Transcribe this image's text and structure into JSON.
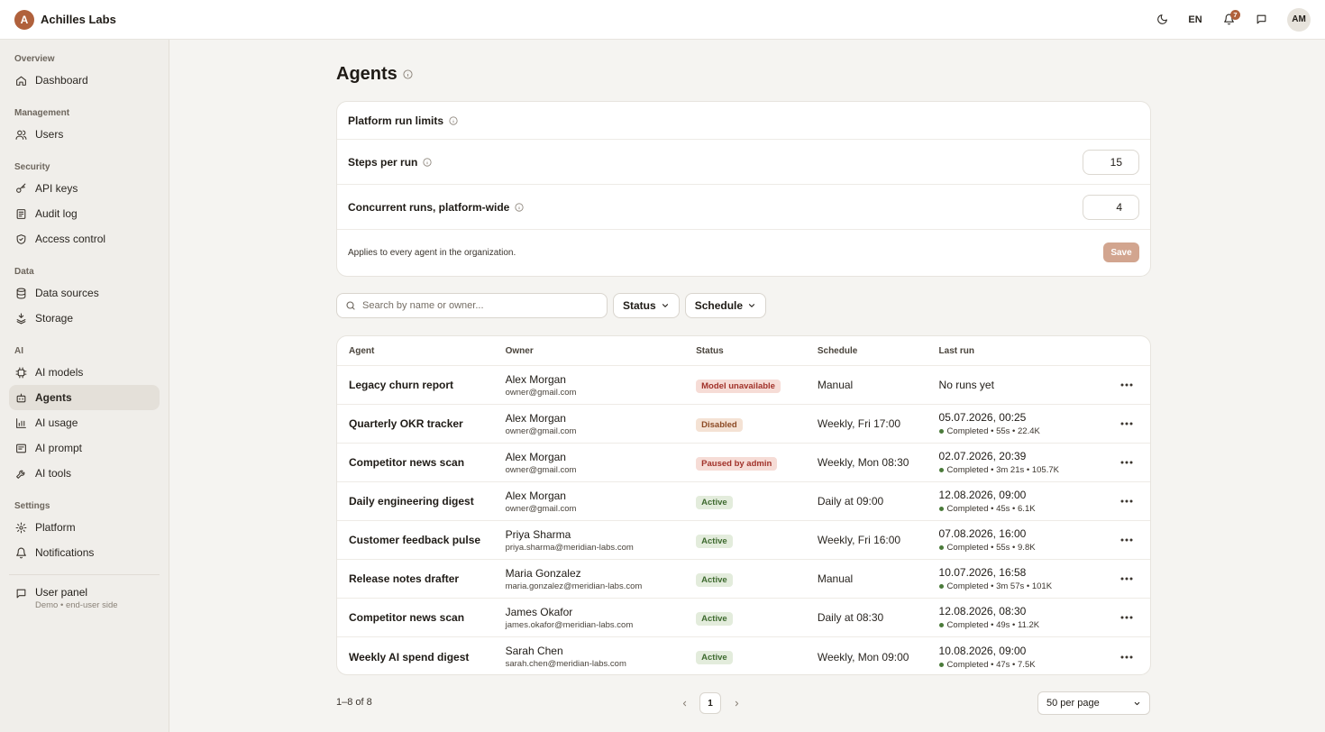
{
  "app": {
    "logo_letter": "A",
    "name": "Achilles Labs"
  },
  "topbar": {
    "lang": "EN",
    "notif_count": "7",
    "avatar": "AM"
  },
  "sidebar": {
    "groups": [
      {
        "label": "Overview",
        "items": [
          {
            "label": "Dashboard",
            "icon": "home-icon"
          }
        ]
      },
      {
        "label": "Management",
        "items": [
          {
            "label": "Users",
            "icon": "users-icon"
          }
        ]
      },
      {
        "label": "Security",
        "items": [
          {
            "label": "API keys",
            "icon": "key-icon"
          },
          {
            "label": "Audit log",
            "icon": "scroll-icon"
          },
          {
            "label": "Access control",
            "icon": "shield-icon"
          }
        ]
      },
      {
        "label": "Data",
        "items": [
          {
            "label": "Data sources",
            "icon": "database-icon"
          },
          {
            "label": "Storage",
            "icon": "storage-icon"
          }
        ]
      },
      {
        "label": "AI",
        "items": [
          {
            "label": "AI models",
            "icon": "chip-icon"
          },
          {
            "label": "Agents",
            "icon": "bot-icon",
            "active": true
          },
          {
            "label": "AI usage",
            "icon": "chart-icon"
          },
          {
            "label": "AI prompt",
            "icon": "prompt-icon"
          },
          {
            "label": "AI tools",
            "icon": "wrench-icon"
          }
        ]
      },
      {
        "label": "Settings",
        "items": [
          {
            "label": "Platform",
            "icon": "gear-icon"
          },
          {
            "label": "Notifications",
            "icon": "bell-icon"
          }
        ]
      }
    ],
    "user_panel": {
      "title": "User panel",
      "subtitle": "Demo • end-user side"
    }
  },
  "page": {
    "title": "Agents"
  },
  "limits": {
    "title": "Platform run limits",
    "steps_label": "Steps per run",
    "steps_value": "15",
    "concurrent_label": "Concurrent runs, platform-wide",
    "concurrent_value": "4",
    "note": "Applies to every agent in the organization.",
    "save_label": "Save"
  },
  "filters": {
    "search_placeholder": "Search by name or owner...",
    "status_label": "Status",
    "schedule_label": "Schedule"
  },
  "table": {
    "headers": {
      "agent": "Agent",
      "owner": "Owner",
      "status": "Status",
      "schedule": "Schedule",
      "last_run": "Last run"
    },
    "rows": [
      {
        "agent": "Legacy churn report",
        "owner_name": "Alex Morgan",
        "owner_email": "owner@gmail.com",
        "status": "Model unavailable",
        "status_kind": "error",
        "schedule": "Manual",
        "last_date": "No runs yet",
        "last_meta": ""
      },
      {
        "agent": "Quarterly OKR tracker",
        "owner_name": "Alex Morgan",
        "owner_email": "owner@gmail.com",
        "status": "Disabled",
        "status_kind": "disabled",
        "schedule": "Weekly, Fri 17:00",
        "last_date": "05.07.2026, 00:25",
        "last_meta": "Completed • 55s • 22.4K"
      },
      {
        "agent": "Competitor news scan",
        "owner_name": "Alex Morgan",
        "owner_email": "owner@gmail.com",
        "status": "Paused by admin",
        "status_kind": "error",
        "schedule": "Weekly, Mon 08:30",
        "last_date": "02.07.2026, 20:39",
        "last_meta": "Completed • 3m 21s • 105.7K"
      },
      {
        "agent": "Daily engineering digest",
        "owner_name": "Alex Morgan",
        "owner_email": "owner@gmail.com",
        "status": "Active",
        "status_kind": "active",
        "schedule": "Daily at 09:00",
        "last_date": "12.08.2026, 09:00",
        "last_meta": "Completed • 45s • 6.1K"
      },
      {
        "agent": "Customer feedback pulse",
        "owner_name": "Priya Sharma",
        "owner_email": "priya.sharma@meridian-labs.com",
        "status": "Active",
        "status_kind": "active",
        "schedule": "Weekly, Fri 16:00",
        "last_date": "07.08.2026, 16:00",
        "last_meta": "Completed • 55s • 9.8K"
      },
      {
        "agent": "Release notes drafter",
        "owner_name": "Maria Gonzalez",
        "owner_email": "maria.gonzalez@meridian-labs.com",
        "status": "Active",
        "status_kind": "active",
        "schedule": "Manual",
        "last_date": "10.07.2026, 16:58",
        "last_meta": "Completed • 3m 57s • 101K"
      },
      {
        "agent": "Competitor news scan",
        "owner_name": "James Okafor",
        "owner_email": "james.okafor@meridian-labs.com",
        "status": "Active",
        "status_kind": "active",
        "schedule": "Daily at 08:30",
        "last_date": "12.08.2026, 08:30",
        "last_meta": "Completed • 49s • 11.2K"
      },
      {
        "agent": "Weekly AI spend digest",
        "owner_name": "Sarah Chen",
        "owner_email": "sarah.chen@meridian-labs.com",
        "status": "Active",
        "status_kind": "active",
        "schedule": "Weekly, Mon 09:00",
        "last_date": "10.08.2026, 09:00",
        "last_meta": "Completed • 47s • 7.5K"
      }
    ]
  },
  "pagination": {
    "count": "1–8 of 8",
    "page": "1",
    "per_page": "50 per page"
  },
  "colors": {
    "accent": "#b0613c",
    "badge_error_bg": "#f6dcd6",
    "badge_error_fg": "#a1322a",
    "badge_disabled_bg": "#f4e2d4",
    "badge_disabled_fg": "#8c4a24",
    "badge_active_bg": "#e3ecdc",
    "badge_active_fg": "#3e6a2f"
  }
}
